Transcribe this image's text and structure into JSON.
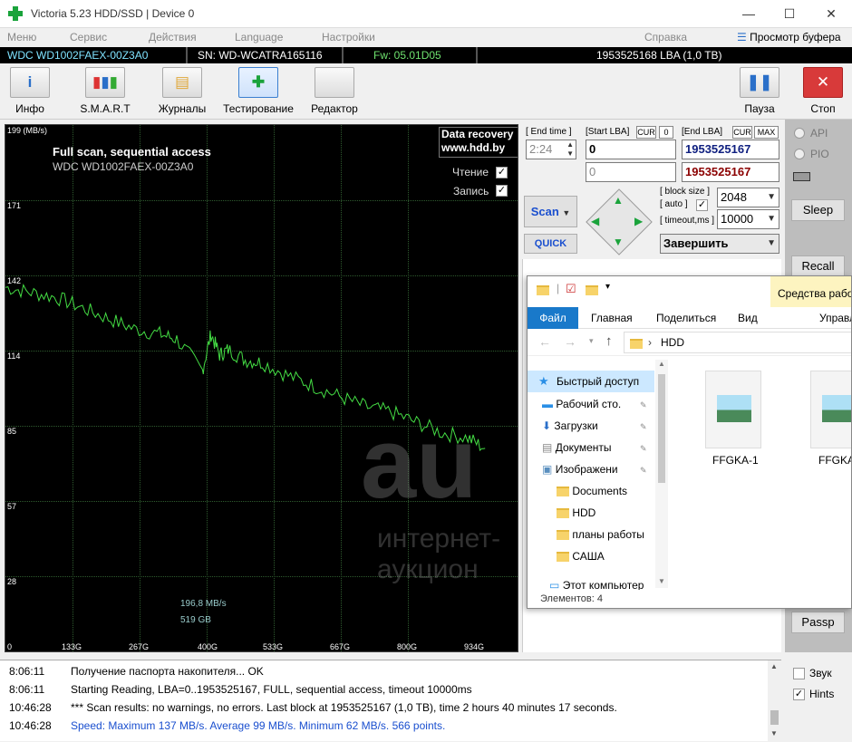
{
  "window": {
    "title": "Victoria 5.23 HDD/SSD | Device 0",
    "minimize": "—",
    "maximize": "☐",
    "close": "✕"
  },
  "menu": {
    "items": [
      "Меню",
      "Сервис",
      "Действия",
      "Language",
      "Настройки",
      "Справка"
    ],
    "clipboard": "Просмотр буфера"
  },
  "drive": {
    "model": "WDC WD1002FAEX-00Z3A0",
    "serial": "SN: WD-WCATRA165116",
    "firmware": "Fw: 05.01D05",
    "capacity": "1953525168 LBA (1,0 TB)"
  },
  "toolbar": {
    "info": "Инфо",
    "smart": "S.M.A.R.T",
    "logs": "Журналы",
    "test": "Тестирование",
    "editor": "Редактор",
    "pause": "Пауза",
    "stop": "Стоп"
  },
  "graph": {
    "title": "Full scan, sequential access",
    "model": "WDC WD1002FAEX-00Z3A0",
    "recovery_line1": "Data recovery",
    "recovery_line2": "www.hdd.by",
    "read_label": "Чтение",
    "write_label": "Запись",
    "read_checked": true,
    "write_checked": true,
    "unit": "199 (MB/s)",
    "y_ticks": [
      "171",
      "142",
      "114",
      "85",
      "57",
      "28",
      "0"
    ],
    "x_ticks": [
      "133G",
      "267G",
      "400G",
      "533G",
      "667G",
      "800G",
      "934G"
    ],
    "current_speed": "196,8 MB/s",
    "current_pos": "519 GB",
    "line_color": "#44dd44"
  },
  "chart_data": {
    "type": "line",
    "title": "Full scan, sequential access",
    "xlabel": "",
    "ylabel": "MB/s",
    "ylim": [
      0,
      199
    ],
    "xlim": [
      0,
      1000
    ],
    "series": [
      {
        "x": [
          0,
          30,
          60,
          90,
          120,
          150,
          180,
          200,
          230,
          240,
          250,
          260,
          280,
          300,
          330,
          360,
          390,
          420,
          450,
          480,
          510,
          540,
          560
        ],
        "values": [
          138,
          136,
          134,
          130,
          126,
          122,
          120,
          118,
          106,
          120,
          112,
          114,
          110,
          109,
          104,
          100,
          96,
          92,
          90,
          86,
          82,
          80,
          76
        ]
      }
    ]
  },
  "scan": {
    "end_time_label": "[ End time ]",
    "end_time": "2:24",
    "start_lba_label": "[Start LBA]",
    "cur_label": "CUR",
    "zero_label": "0",
    "start_lba": "0",
    "start_lba2": "0",
    "end_lba_label": "[End LBA]",
    "max_label": "MAX",
    "end_lba": "1953525167",
    "end_lba2": "1953525167",
    "scan_button": "Scan",
    "quick_button": "QUICK",
    "block_size_label": "[ block size ]",
    "auto_label": "[ auto ]",
    "timeout_label": "[ timeout,ms ]",
    "block_size": "2048",
    "timeout": "10000",
    "finish_select": "Завершить"
  },
  "right": {
    "api": "API",
    "pio": "PIO",
    "sleep": "Sleep",
    "recall": "Recall",
    "passp": "Passp",
    "sound": "Звук",
    "hints": "Hints"
  },
  "explorer": {
    "tab_file": "Файл",
    "tab_home": "Главная",
    "tab_share": "Поделиться",
    "tab_view": "Вид",
    "picture_tools": "Средства работ",
    "manage": "Управл",
    "path": "HDD",
    "quick_access": "Быстрый доступ",
    "nav": [
      "Рабочий сто.",
      "Загрузки",
      "Документы",
      "Изображени",
      "Documents",
      "HDD",
      "планы работы",
      "САША"
    ],
    "this_pc": "Этот компьютер",
    "file1": "FFGKA-1",
    "file2": "FFGKA-",
    "status": "Элементов: 4"
  },
  "log": [
    {
      "time": "8:06:11",
      "text": "Получение паспорта накопителя... OK",
      "color": "#000000"
    },
    {
      "time": "8:06:11",
      "text": "Starting Reading, LBA=0..1953525167, FULL, sequential access, timeout 10000ms",
      "color": "#000000"
    },
    {
      "time": "10:46:28",
      "text": "*** Scan results: no warnings, no errors. Last block at 1953525167 (1,0 TB), time 2 hours 40 minutes 17 seconds.",
      "color": "#000000"
    },
    {
      "time": "10:46:28",
      "text": "Speed: Maximum 137 MB/s. Average 99 MB/s. Minimum 62 MB/s. 566 points.",
      "color": "#1a4fcf"
    }
  ],
  "watermark": {
    "big": "au",
    "small": "интернет-аукцион"
  }
}
